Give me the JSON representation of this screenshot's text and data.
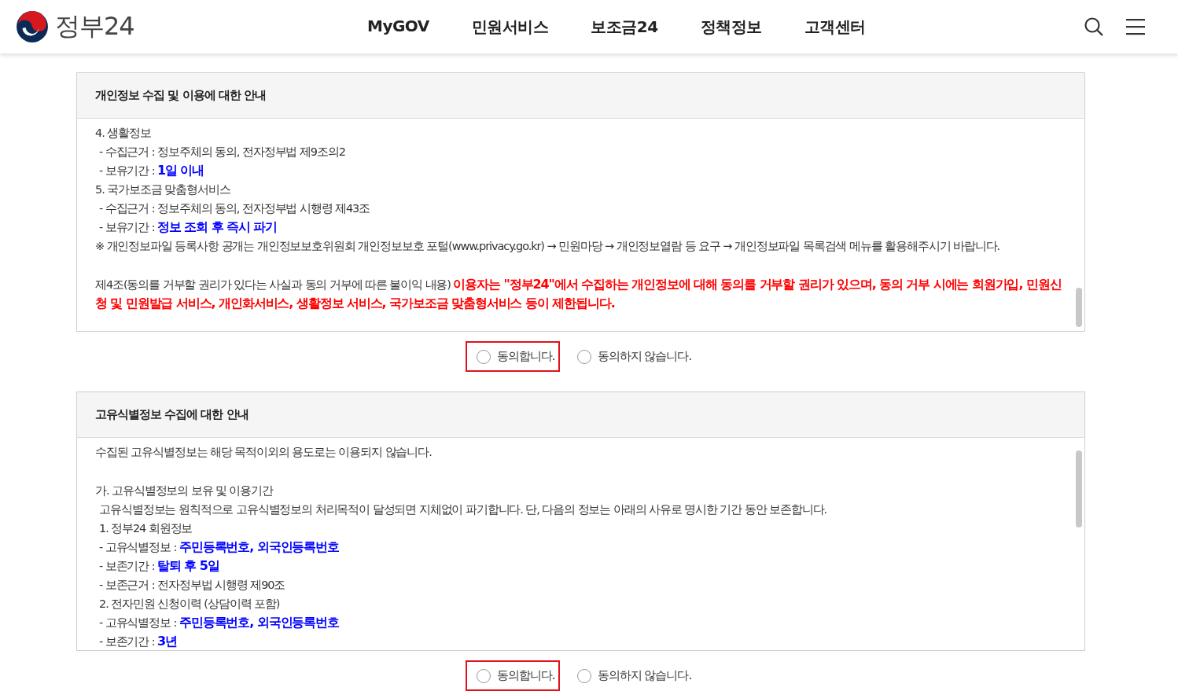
{
  "header": {
    "logo_text": "정부24",
    "nav": [
      {
        "label": "MyGOV"
      },
      {
        "label": "민원서비스"
      },
      {
        "label": "보조금24"
      },
      {
        "label": "정책정보"
      },
      {
        "label": "고객센터"
      }
    ]
  },
  "sections": [
    {
      "title": "개인정보 수집 및 이용에 대한 안내",
      "lines": [
        {
          "segments": [
            {
              "text": "4. 생활정보"
            }
          ]
        },
        {
          "indent": true,
          "segments": [
            {
              "text": "- 수집근거 : 정보주체의 동의, 전자정부법 제9조의2"
            }
          ]
        },
        {
          "indent": true,
          "segments": [
            {
              "text": "- 보유기간 : "
            },
            {
              "text": "1일 이내",
              "kind": "emphasis"
            }
          ]
        },
        {
          "segments": [
            {
              "text": "5. 국가보조금 맞춤형서비스"
            }
          ]
        },
        {
          "indent": true,
          "segments": [
            {
              "text": "- 수집근거 : 정보주체의 동의, 전자정부법 시행령 제43조"
            }
          ]
        },
        {
          "indent": true,
          "segments": [
            {
              "text": "- 보유기간 : "
            },
            {
              "text": "정보 조회 후 즉시 파기",
              "kind": "emphasis"
            }
          ]
        },
        {
          "segments": [
            {
              "text": "※ 개인정보파일 등록사항 공개는 개인정보보호위원회 개인정보보호 포털(www.privacy.go.kr) → 민원마당 → 개인정보열람 등 요구 → 개인정보파일 목록검색 메뉴를 활용해주시기 바랍니다."
            }
          ]
        },
        {
          "gap_before": true,
          "segments": [
            {
              "text": "제4조(동의를 거부할 권리가 있다는 사실과 동의 거부에 따른 불이익 내용) "
            },
            {
              "text": "이용자는 \"정부24\"에서 수집하는 개인정보에 대해 동의를 거부할 권리가 있으며, 동의 거부 시에는 회원가입, 민원신청 및 민원발급 서비스, 개인화서비스, 생활정보 서비스, 국가보조금 맞춤형서비스 등이 제한됩니다.",
              "kind": "warning"
            }
          ]
        }
      ],
      "options": [
        {
          "label": "동의합니다.",
          "selected": false,
          "highlighted": true
        },
        {
          "label": "동의하지 않습니다.",
          "selected": false,
          "highlighted": false
        }
      ]
    },
    {
      "title": "고유식별정보 수집에 대한 안내",
      "lines": [
        {
          "segments": [
            {
              "text": "수집된 고유식별정보는 해당 목적이외의 용도로는 이용되지 않습니다."
            }
          ]
        },
        {
          "gap_before": true,
          "segments": [
            {
              "text": "가. 고유식별정보의 보유 및 이용기간"
            }
          ]
        },
        {
          "indent": true,
          "segments": [
            {
              "text": "고유식별정보는 원칙적으로 고유식별정보의 처리목적이 달성되면 지체없이 파기합니다. 단, 다음의 정보는 아래의 사유로 명시한 기간 동안 보존합니다."
            }
          ]
        },
        {
          "indent": true,
          "segments": [
            {
              "text": "1. 정부24 회원정보"
            }
          ]
        },
        {
          "indent": true,
          "segments": [
            {
              "text": "- 고유식별정보 : "
            },
            {
              "text": "주민등록번호, 외국인등록번호",
              "kind": "emphasis"
            }
          ]
        },
        {
          "indent": true,
          "segments": [
            {
              "text": "- 보존기간 : "
            },
            {
              "text": "탈퇴 후 5일",
              "kind": "emphasis"
            }
          ]
        },
        {
          "indent": true,
          "segments": [
            {
              "text": "- 보존근거 : 전자정부법 시행령 제90조"
            }
          ]
        },
        {
          "indent": true,
          "segments": [
            {
              "text": "2. 전자민원 신청이력 (상담이력 포함)"
            }
          ]
        },
        {
          "indent": true,
          "segments": [
            {
              "text": "- 고유식별정보 : "
            },
            {
              "text": "주민등록번호, 외국인등록번호",
              "kind": "emphasis"
            }
          ]
        },
        {
          "indent": true,
          "segments": [
            {
              "text": "- 보존기간 : "
            },
            {
              "text": "3년",
              "kind": "emphasis"
            }
          ]
        }
      ],
      "options": [
        {
          "label": "동의합니다.",
          "selected": false,
          "highlighted": true
        },
        {
          "label": "동의하지 않습니다.",
          "selected": false,
          "highlighted": false
        }
      ]
    }
  ]
}
